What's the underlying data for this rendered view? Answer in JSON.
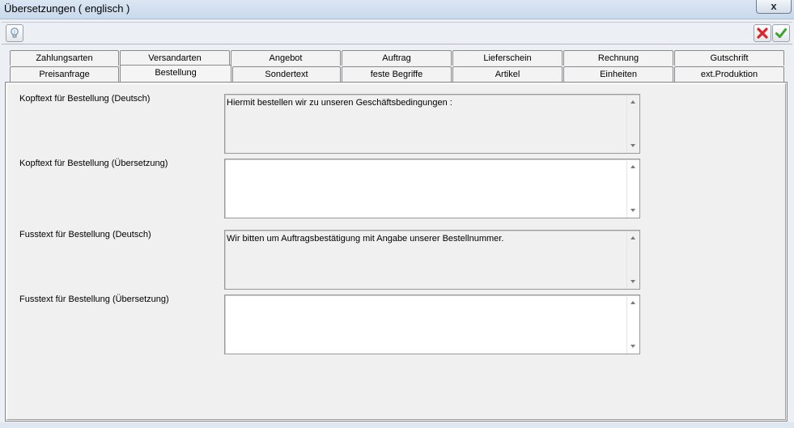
{
  "window": {
    "title": "Übersetzungen ( englisch )",
    "close_label": "x"
  },
  "toolbar": {
    "info_icon": "lightbulb-icon",
    "cancel_icon": "red-x-icon",
    "ok_icon": "green-check-icon"
  },
  "tabs": {
    "row1": [
      "Zahlungsarten",
      "Versandarten",
      "Angebot",
      "Auftrag",
      "Lieferschein",
      "Rechnung",
      "Gutschrift"
    ],
    "row2": [
      "Preisanfrage",
      "Bestellung",
      "Sondertext",
      "feste Begriffe",
      "Artikel",
      "Einheiten",
      "ext.Produktion"
    ],
    "active": "Bestellung"
  },
  "fields": [
    {
      "label": "Kopftext für Bestellung (Deutsch)",
      "value": "Hiermit bestellen wir zu unseren Geschäftsbedingungen :",
      "readonly": true
    },
    {
      "label": "Kopftext für Bestellung (Übersetzung)",
      "value": "",
      "readonly": false
    },
    {
      "label": "Fusstext für Bestellung (Deutsch)",
      "value": "Wir bitten um Auftragsbestätigung mit Angabe unserer Bestellnummer.",
      "readonly": true
    },
    {
      "label": "Fusstext für Bestellung (Übersetzung)",
      "value": "",
      "readonly": false
    }
  ],
  "colors": {
    "cancel": "#d9262b",
    "ok": "#3fa02c"
  }
}
